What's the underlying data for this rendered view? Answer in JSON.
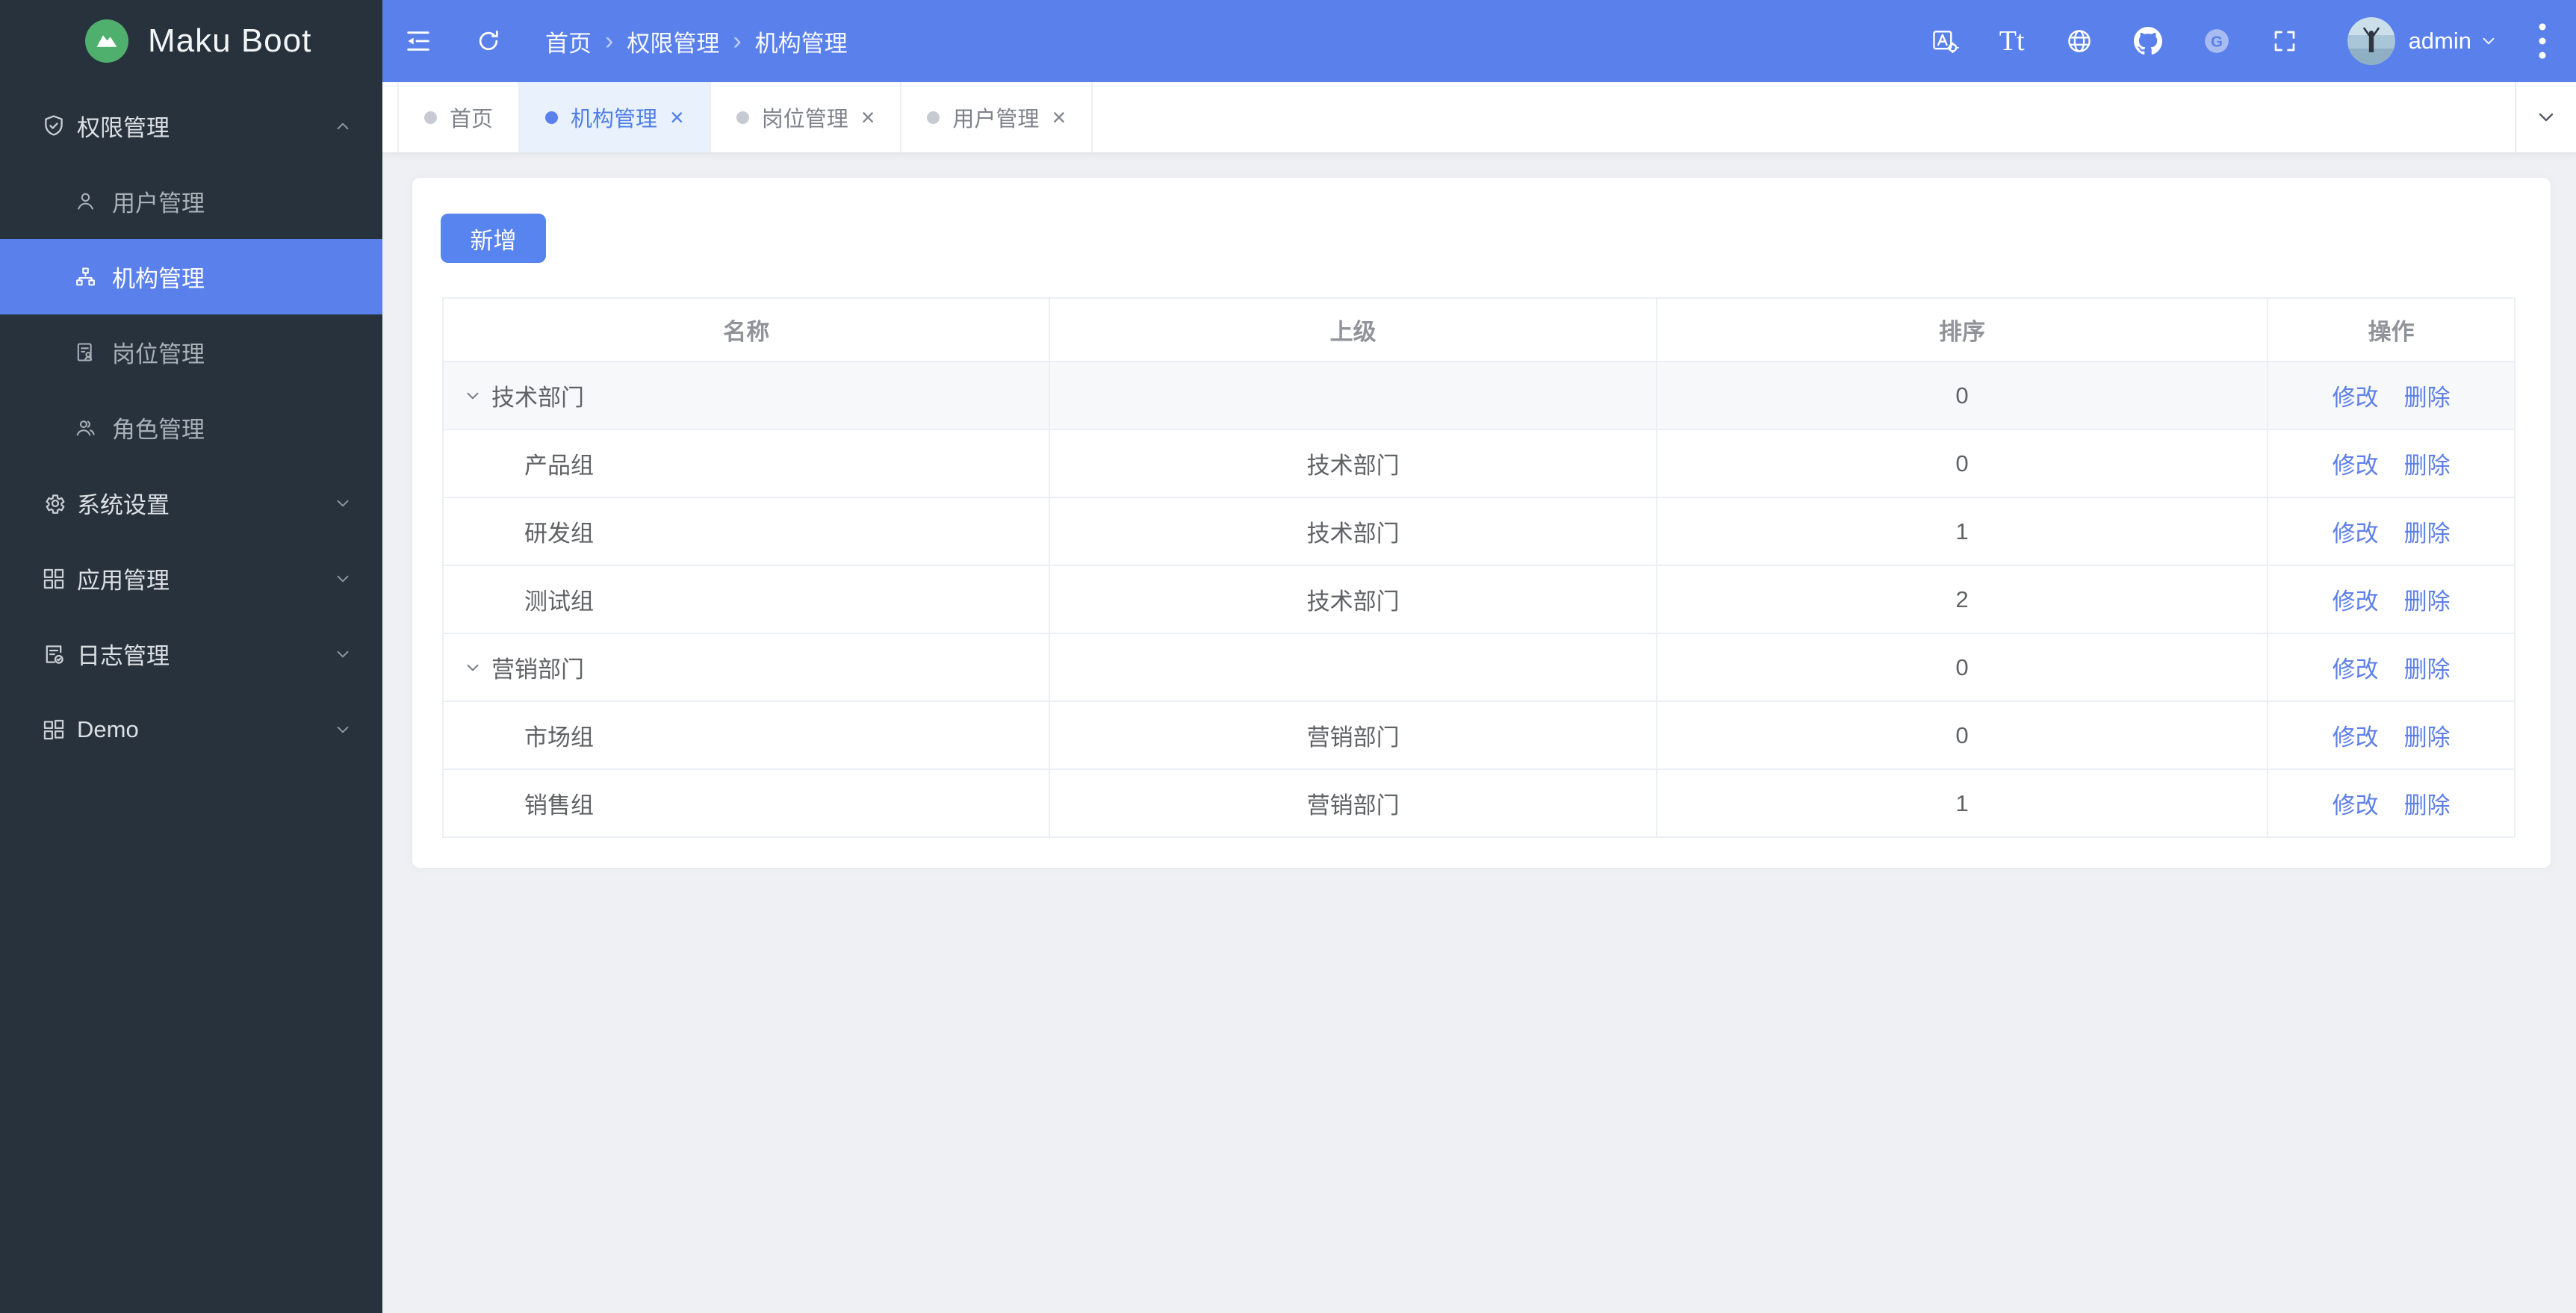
{
  "app": {
    "title": "Maku Boot"
  },
  "header": {
    "breadcrumb": {
      "items": [
        "首页",
        "权限管理",
        "机构管理"
      ],
      "separator": "›"
    },
    "font_icon_text": "Tt",
    "gitee_letter": "G",
    "user": {
      "name": "admin"
    }
  },
  "sidebar": {
    "items": [
      {
        "label": "权限管理",
        "icon": "shield-check-icon",
        "expanded": true,
        "children": [
          {
            "label": "用户管理",
            "icon": "user-icon",
            "active": false
          },
          {
            "label": "机构管理",
            "icon": "org-icon",
            "active": true
          },
          {
            "label": "岗位管理",
            "icon": "post-icon",
            "active": false
          },
          {
            "label": "角色管理",
            "icon": "roles-icon",
            "active": false
          }
        ]
      },
      {
        "label": "系统设置",
        "icon": "gear-icon",
        "expanded": false
      },
      {
        "label": "应用管理",
        "icon": "apps-icon",
        "expanded": false
      },
      {
        "label": "日志管理",
        "icon": "log-icon",
        "expanded": false
      },
      {
        "label": "Demo",
        "icon": "demo-grid-icon",
        "expanded": false
      }
    ]
  },
  "tabs": {
    "close_glyph": "×",
    "items": [
      {
        "label": "首页",
        "active": false,
        "closable": false
      },
      {
        "label": "机构管理",
        "active": true,
        "closable": true
      },
      {
        "label": "岗位管理",
        "active": false,
        "closable": true
      },
      {
        "label": "用户管理",
        "active": false,
        "closable": true
      }
    ]
  },
  "toolbar": {
    "add_label": "新增"
  },
  "table": {
    "columns": [
      "名称",
      "上级",
      "排序",
      "操作"
    ],
    "actions": {
      "edit": "修改",
      "delete": "删除"
    },
    "rows": [
      {
        "name": "技术部门",
        "parent": "",
        "sort": "0",
        "level": 0,
        "expanded": true,
        "highlighted": true
      },
      {
        "name": "产品组",
        "parent": "技术部门",
        "sort": "0",
        "level": 1
      },
      {
        "name": "研发组",
        "parent": "技术部门",
        "sort": "1",
        "level": 1
      },
      {
        "name": "测试组",
        "parent": "技术部门",
        "sort": "2",
        "level": 1
      },
      {
        "name": "营销部门",
        "parent": "",
        "sort": "0",
        "level": 0,
        "expanded": true
      },
      {
        "name": "市场组",
        "parent": "营销部门",
        "sort": "0",
        "level": 1
      },
      {
        "name": "销售组",
        "parent": "营销部门",
        "sort": "1",
        "level": 1
      }
    ]
  },
  "colors": {
    "accent_blue": "#5A80EC",
    "button_blue": "#5784EE",
    "sidebar_bg": "#28323C",
    "content_bg": "#EEF0F4",
    "active_tab_bg": "#E9F1FD",
    "logo_green": "#4FAF6D",
    "link_blue": "#5E7FE9",
    "table_border": "#EBEEF5",
    "table_header_text": "#909399",
    "table_body_text": "#606266",
    "row_highlight": "#F6F8FA"
  }
}
